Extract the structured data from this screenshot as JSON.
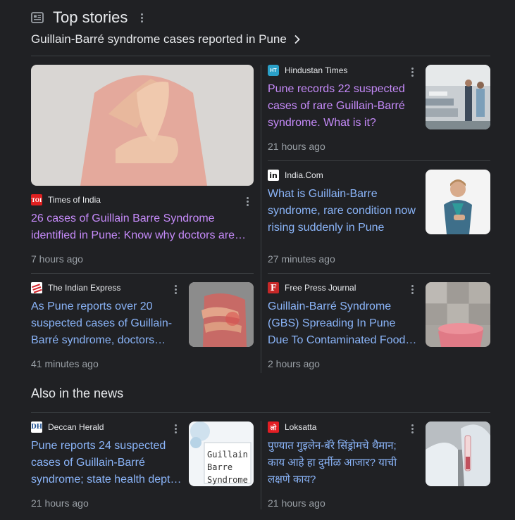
{
  "header": {
    "title": "Top stories",
    "topic": "Guillain-Barré syndrome cases reported in Pune"
  },
  "stories": [
    {
      "source": "Times of India",
      "logo_text": "TOI",
      "title_lines": [
        "26 cases of Guillain Barre Syndrome",
        "identified in Pune: Know why doctors are…"
      ],
      "time": "7 hours ago"
    },
    {
      "source": "Hindustan Times",
      "logo_text": "HT",
      "title_lines": [
        "Pune records 22 suspected",
        "cases of rare Guillain-Barré",
        "syndrome. What is it?"
      ],
      "time": "21 hours ago"
    },
    {
      "source": "India.Com",
      "logo_text": "in",
      "title_lines": [
        "What is Guillain-Barre",
        "syndrome, rare condition now",
        "rising suddenly in Pune"
      ],
      "time": "27 minutes ago"
    },
    {
      "source": "The Indian Express",
      "logo_text": "",
      "title_lines": [
        "As Pune reports over 20",
        "suspected cases of Guillain-",
        "Barré syndrome, doctors…"
      ],
      "time": "41 minutes ago"
    },
    {
      "source": "Free Press Journal",
      "logo_text": "F",
      "title_lines": [
        "Guillain-Barré Syndrome",
        "(GBS) Spreading In Pune",
        "Due To Contaminated Food…"
      ],
      "time": "2 hours ago"
    }
  ],
  "also": {
    "heading": "Also in the news",
    "stories": [
      {
        "source": "Deccan Herald",
        "logo_text": "DH",
        "title_lines": [
          "Pune reports 24 suspected",
          "cases of Guillain-Barré",
          "syndrome; state health dept…"
        ],
        "time": "21 hours ago",
        "thumb_text": [
          "Guillain",
          "Barre",
          "Syndrome"
        ]
      },
      {
        "source": "Loksatta",
        "logo_text": "लो",
        "title_lines": [
          "पुण्यात गुइलेन-बॅरे सिंड्रोमचे थैमान;",
          "काय आहे हा दुर्मीळ आजार? याची",
          "लक्षणे काय?"
        ],
        "time": "21 hours ago"
      }
    ]
  },
  "colors": {
    "background": "#202124",
    "link_blue": "#8ab4f8",
    "link_visited": "#c58af9",
    "meta_gray": "#9aa0a6",
    "divider": "#3c4043"
  },
  "icons": [
    "newspaper-icon",
    "more-vert-icon",
    "chevron-right-icon"
  ]
}
